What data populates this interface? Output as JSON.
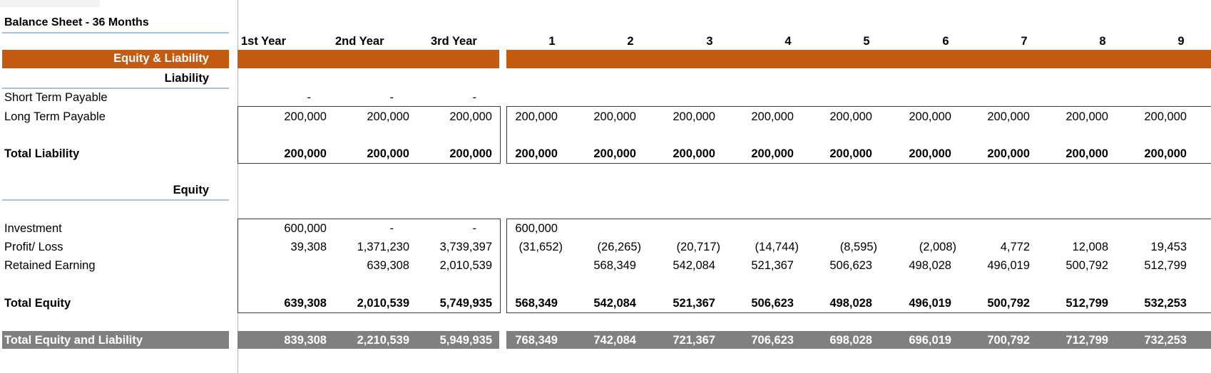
{
  "sheet_title": "Balance Sheet - 36 Months",
  "sections": {
    "equity_liability": "Equity & Liability",
    "liability": "Liability",
    "equity": "Equity"
  },
  "year_headers": [
    "1st Year",
    "2nd Year",
    "3rd Year"
  ],
  "month_headers": [
    "1",
    "2",
    "3",
    "4",
    "5",
    "6",
    "7",
    "8",
    "9"
  ],
  "rows": {
    "short_term_payable": {
      "label": "Short Term Payable",
      "years": [
        "-",
        "-",
        "-"
      ],
      "months": [
        "",
        "",
        "",
        "",
        "",
        "",
        "",
        "",
        ""
      ]
    },
    "long_term_payable": {
      "label": "Long Term Payable",
      "years": [
        "200,000",
        "200,000",
        "200,000"
      ],
      "months": [
        "200,000",
        "200,000",
        "200,000",
        "200,000",
        "200,000",
        "200,000",
        "200,000",
        "200,000",
        "200,000"
      ]
    },
    "total_liability": {
      "label": "Total Liability",
      "years": [
        "200,000",
        "200,000",
        "200,000"
      ],
      "months": [
        "200,000",
        "200,000",
        "200,000",
        "200,000",
        "200,000",
        "200,000",
        "200,000",
        "200,000",
        "200,000"
      ]
    },
    "investment": {
      "label": "Investment",
      "years": [
        "600,000",
        "-",
        "-"
      ],
      "months": [
        "600,000",
        "",
        "",
        "",
        "",
        "",
        "",
        "",
        ""
      ]
    },
    "profit_loss": {
      "label": "Profit/ Loss",
      "years": [
        "39,308",
        "1,371,230",
        "3,739,397"
      ],
      "months": [
        "(31,652)",
        "(26,265)",
        "(20,717)",
        "(14,744)",
        "(8,595)",
        "(2,008)",
        "4,772",
        "12,008",
        "19,453"
      ]
    },
    "retained_earning": {
      "label": "Retained Earning",
      "years": [
        "",
        "639,308",
        "2,010,539"
      ],
      "months": [
        "",
        "568,349",
        "542,084",
        "521,367",
        "506,623",
        "498,028",
        "496,019",
        "500,792",
        "512,799"
      ]
    },
    "total_equity": {
      "label": "Total Equity",
      "years": [
        "639,308",
        "2,010,539",
        "5,749,935"
      ],
      "months": [
        "568,349",
        "542,084",
        "521,367",
        "506,623",
        "498,028",
        "496,019",
        "500,792",
        "512,799",
        "532,253"
      ]
    },
    "total_equity_liability": {
      "label": "Total Equity and Liability",
      "years": [
        "839,308",
        "2,210,539",
        "5,949,935"
      ],
      "months": [
        "768,349",
        "742,084",
        "721,367",
        "706,623",
        "698,028",
        "696,019",
        "700,792",
        "712,799",
        "732,253"
      ]
    }
  },
  "colors": {
    "section_band": "#c55a11",
    "total_band": "#808080",
    "underline": "#9dc3e6"
  }
}
